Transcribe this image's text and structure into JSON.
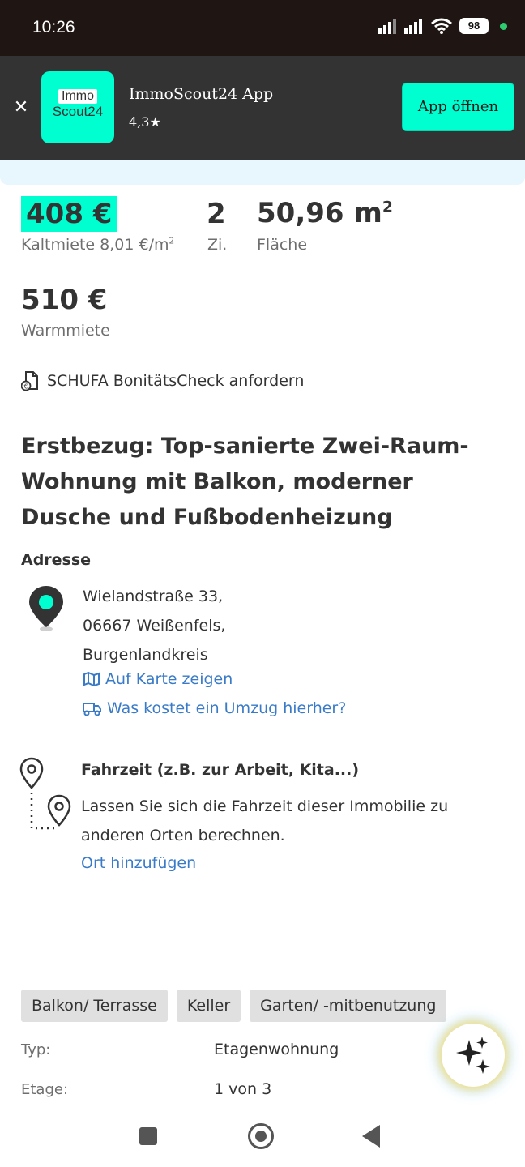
{
  "status_bar": {
    "time": "10:26",
    "battery": "98"
  },
  "app_banner": {
    "logo_line1": "Immo",
    "logo_line2": "Scout24",
    "app_name": "ImmoScout24 App",
    "rating": "4,3★",
    "open_button": "App öffnen"
  },
  "key_facts": {
    "cold_rent": "408 €",
    "cold_rent_sub": "Kaltmiete 8,01 €/m",
    "rooms": "2",
    "rooms_sub": "Zi.",
    "area": "50,96 m",
    "area_sub": "Fläche",
    "warm_rent": "510 €",
    "warm_rent_sub": "Warmmiete",
    "squared": "2"
  },
  "schufa_link": "SCHUFA BonitätsCheck anfordern",
  "listing_title": "Erstbezug: Top-sanierte Zwei-Raum-Wohnung mit Balkon, moderner Dusche und Fußbodenheizung",
  "address": {
    "label": "Adresse",
    "line1": "Wielandstraße 33,",
    "line2": "06667 Weißenfels,",
    "line3": "Burgenlandkreis",
    "map_link": "Auf Karte zeigen",
    "moving_link": "Was kostet ein Umzug hierher?"
  },
  "commute": {
    "title": "Fahrzeit (z.B. zur Arbeit, Kita...)",
    "description": "Lassen Sie sich die Fahrzeit dieser Immobilie zu anderen Orten berechnen.",
    "add_link": "Ort hinzufügen"
  },
  "tags": [
    "Balkon/ Terrasse",
    "Keller",
    "Garten/ -mitbenutzung"
  ],
  "details": [
    {
      "key": "Typ:",
      "value": "Etagenwohnung"
    },
    {
      "key": "Etage:",
      "value": "1 von 3"
    }
  ],
  "colors": {
    "accent": "#00ffd0",
    "link": "#3a7bc8",
    "banner_bg": "#333333",
    "status_bg": "#1f1613"
  },
  "icons": {
    "close": "close-icon",
    "map": "map-icon",
    "truck": "truck-icon",
    "pin": "location-pin-icon",
    "route": "route-icon",
    "sparkle": "sparkle-icon",
    "document": "euro-document-icon"
  }
}
